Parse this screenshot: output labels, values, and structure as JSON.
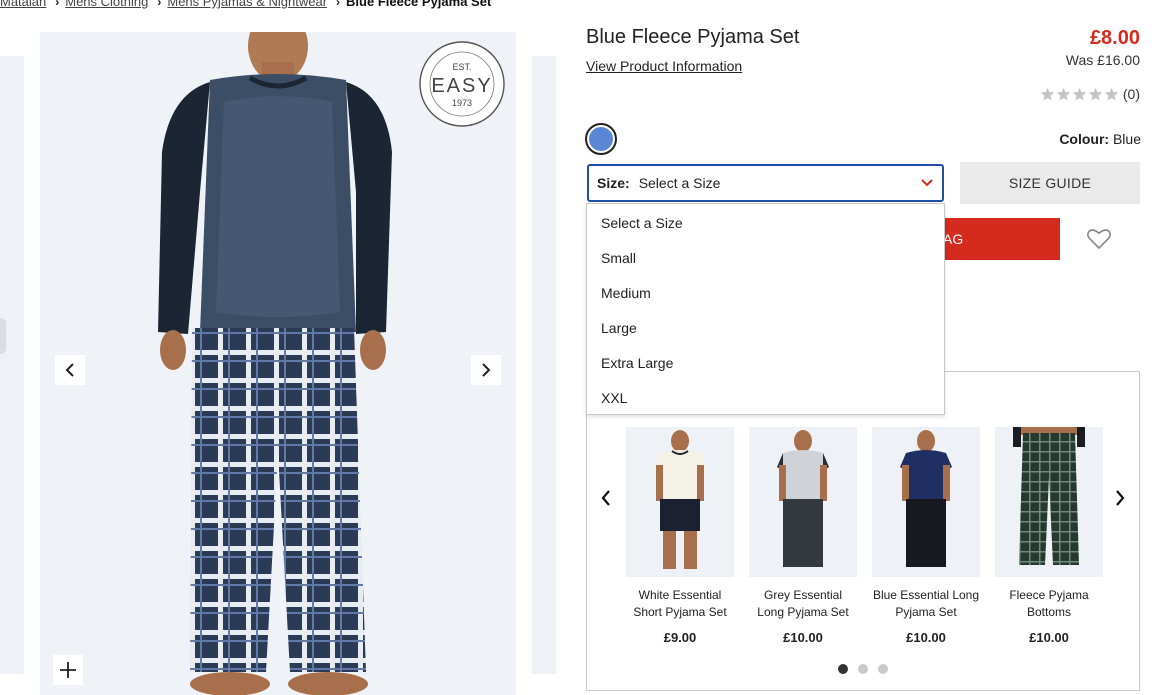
{
  "breadcrumb": [
    {
      "label": "Matalan"
    },
    {
      "label": "Mens Clothing"
    },
    {
      "label": "Mens Pyjamas & Nightwear"
    }
  ],
  "breadcrumb_current": "Blue Fleece Pyjama Set",
  "product": {
    "title": "Blue Fleece Pyjama Set",
    "view_info": "View Product Information",
    "price": "£8.00",
    "was_price": "Was £16.00",
    "rating_count": "(0)",
    "rating_stars": 0,
    "colour_label": "Colour:",
    "colour_value": "Blue",
    "swatch_color": "#5b86d6",
    "logo_text": "EST. EASY 1973 QUALITY GOODS SINCE 1973"
  },
  "size": {
    "label": "Size:",
    "selected": "Select a Size",
    "options": [
      "Select a Size",
      "Small",
      "Medium",
      "Large",
      "Extra Large",
      "XXL"
    ]
  },
  "size_guide": "SIZE GUIDE",
  "add_to_bag_visible": "AG",
  "colors": {
    "accent_red": "#d52b1e",
    "focus_blue": "#1f4fa8"
  },
  "recommendations": [
    {
      "name": "White Essential Short Pyjama Set",
      "price": "£9.00"
    },
    {
      "name": "Grey Essential Long Pyjama Set",
      "price": "£10.00"
    },
    {
      "name": "Blue Essential Long Pyjama Set",
      "price": "£10.00"
    },
    {
      "name": "Fleece Pyjama Bottoms",
      "price": "£10.00"
    }
  ],
  "carousel_pages": 3,
  "carousel_active": 1
}
